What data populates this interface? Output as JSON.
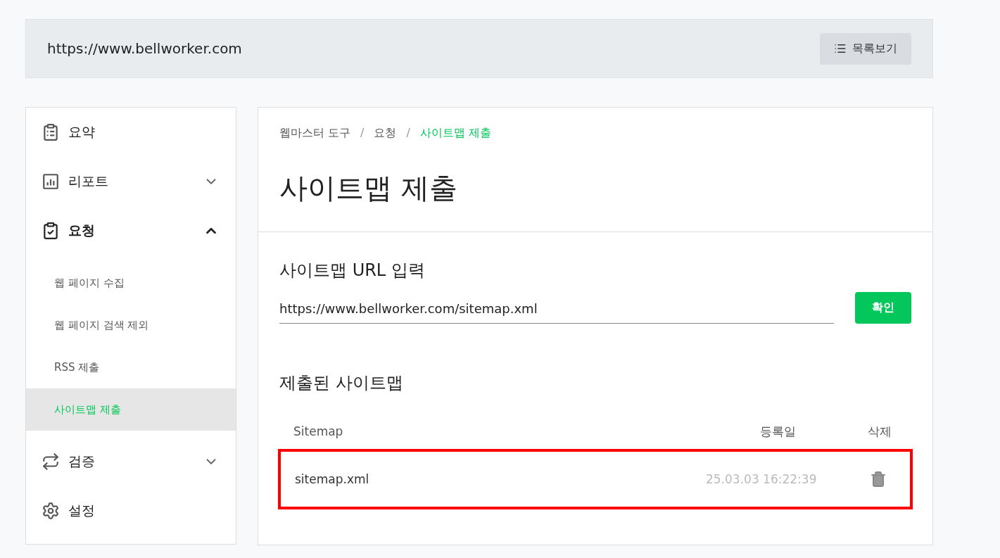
{
  "header": {
    "url": "https://www.bellworker.com",
    "list_button": "목록보기"
  },
  "sidebar": {
    "items": [
      {
        "kind": "summary",
        "label": "요약",
        "selected": false
      },
      {
        "kind": "report",
        "label": "리포트",
        "selected": false,
        "expanded": false
      },
      {
        "kind": "request",
        "label": "요청",
        "selected": true,
        "expanded": true,
        "children": [
          {
            "label": "웹 페이지 수집",
            "selected": false
          },
          {
            "label": "웹 페이지 검색 제외",
            "selected": false
          },
          {
            "label": "RSS 제출",
            "selected": false
          },
          {
            "label": "사이트맵 제출",
            "selected": true
          }
        ]
      },
      {
        "kind": "verify",
        "label": "검증",
        "selected": false,
        "expanded": false
      },
      {
        "kind": "settings",
        "label": "설정",
        "selected": false
      }
    ]
  },
  "breadcrumb": [
    {
      "label": "웹마스터 도구",
      "selected": false
    },
    {
      "label": "/",
      "kind": "separator"
    },
    {
      "label": "요청",
      "selected": false
    },
    {
      "label": "/",
      "kind": "separator"
    },
    {
      "label": "사이트맵 제출",
      "selected": true
    }
  ],
  "title": "사이트맵 제출",
  "url_section": {
    "title": "사이트맵 URL 입력",
    "value": "https://www.bellworker.com/sitemap.xml",
    "button": "확인"
  },
  "submitted": {
    "title": "제출된 사이트맵",
    "columns": [
      "Sitemap",
      "등록일",
      "삭제"
    ],
    "rows": [
      {
        "sitemap": "sitemap.xml",
        "date": "25.03.03 16:22:39",
        "highlighted": true
      }
    ]
  }
}
